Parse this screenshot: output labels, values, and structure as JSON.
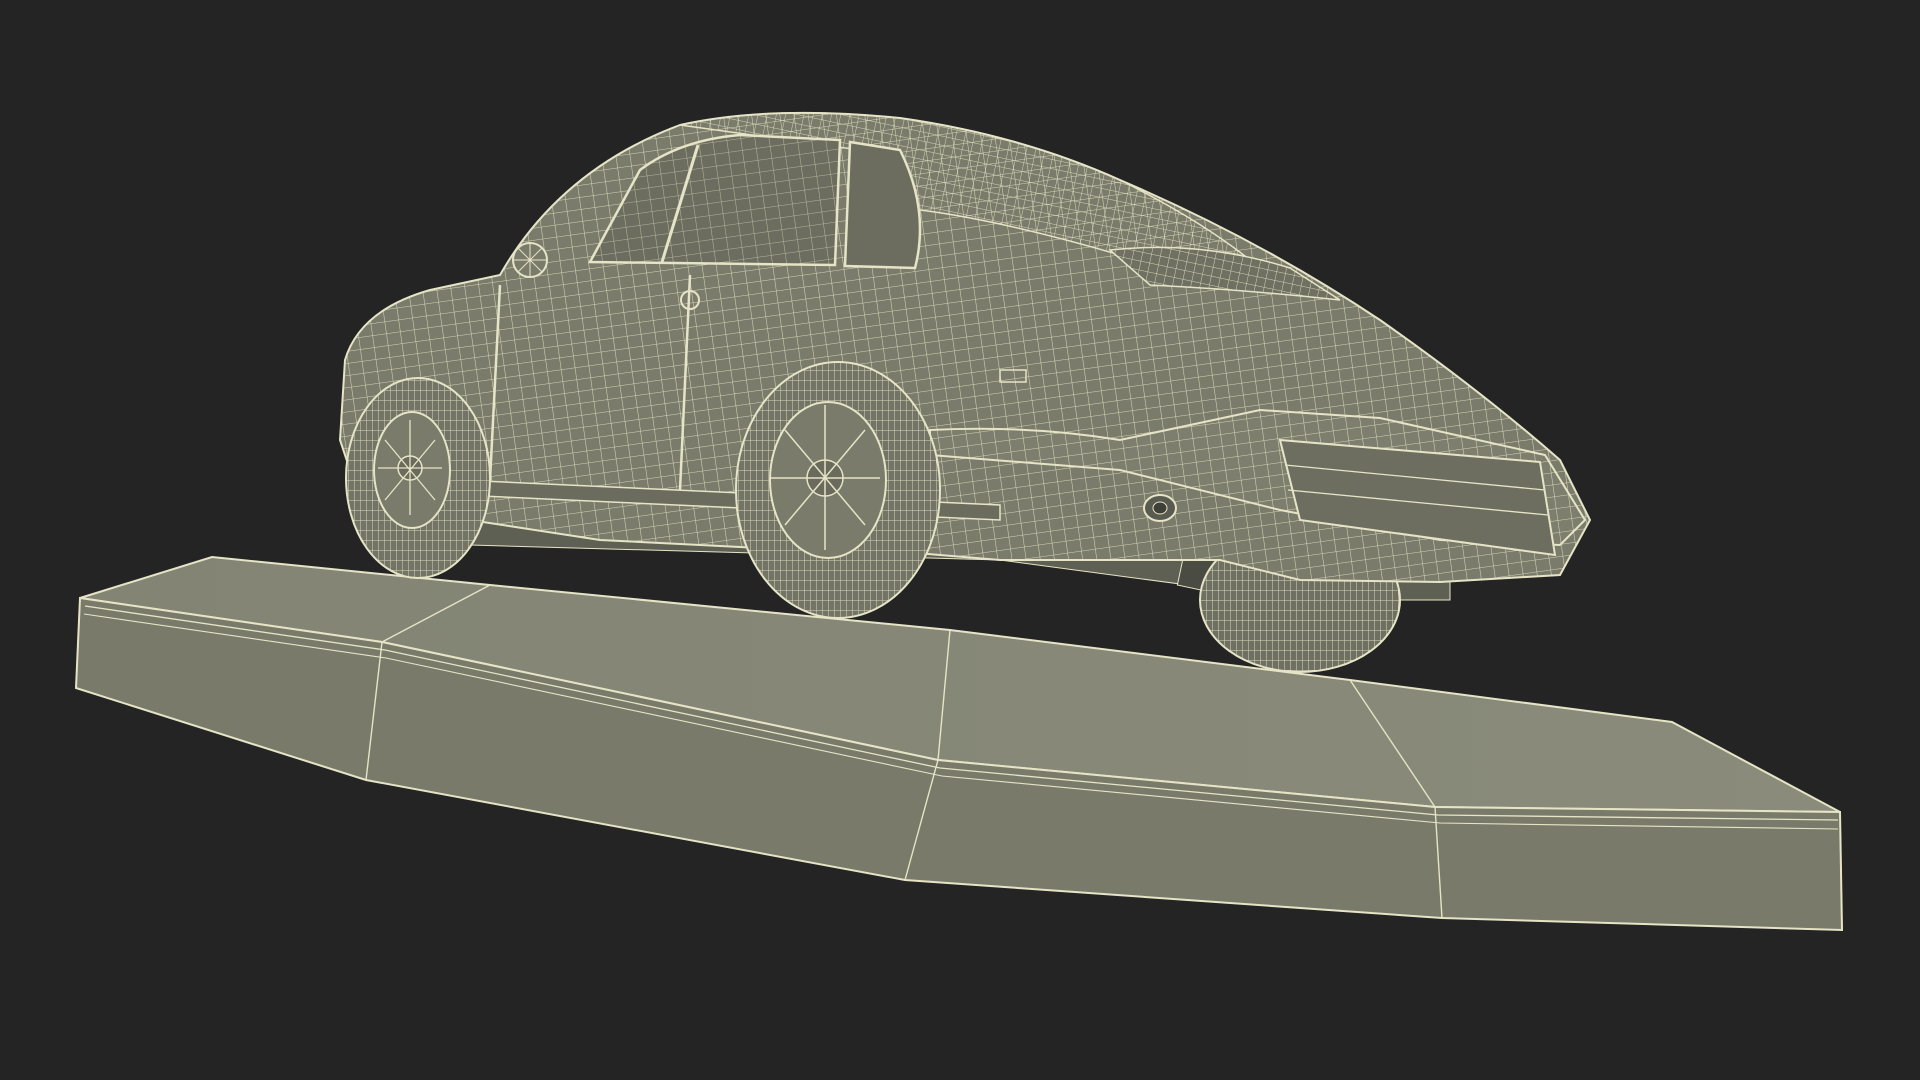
{
  "viewport": {
    "background": "#242424",
    "surface_color": "#7b7c6c",
    "surface_shadow": "#5f6054",
    "surface_light": "#8b8c7b",
    "wire_color": "#e6e4c6",
    "object": "wireframe-car-on-ramp"
  }
}
